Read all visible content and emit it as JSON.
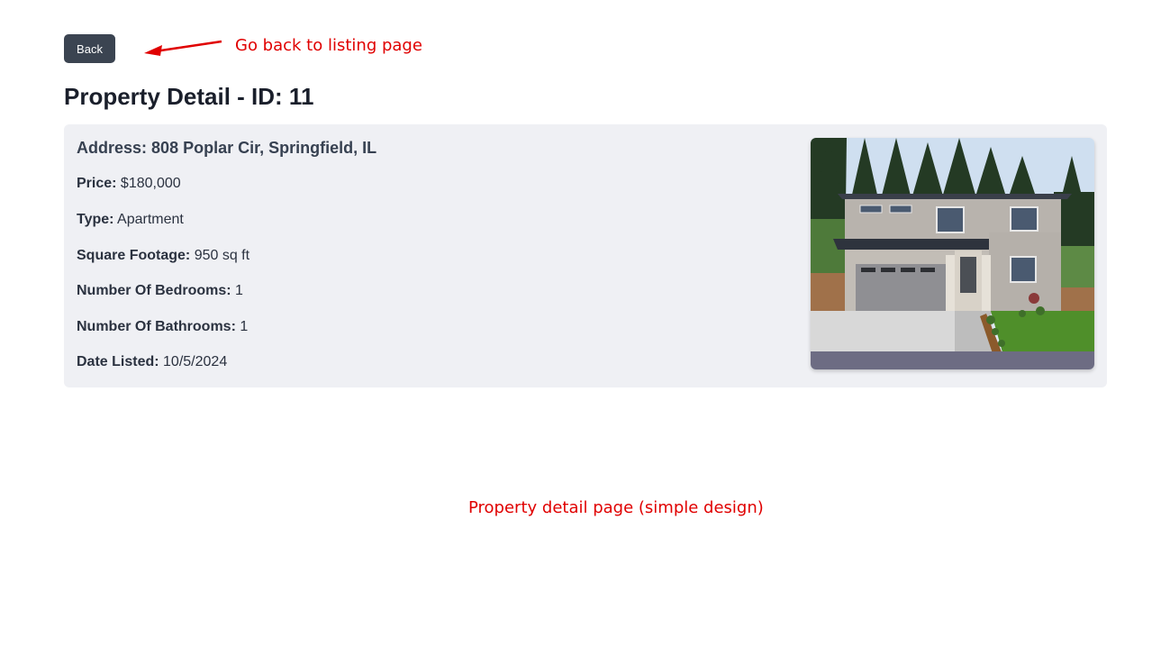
{
  "toolbar": {
    "back_label": "Back"
  },
  "annotations": {
    "back_note": "Go back to listing page",
    "page_note": "Property detail page (simple design)",
    "color": "#e00000"
  },
  "page": {
    "title": "Property Detail - ID: 11"
  },
  "property": {
    "address_label": "Address:",
    "address": "808 Poplar Cir, Springfield, IL",
    "fields": [
      {
        "label": "Price:",
        "value": "$180,000"
      },
      {
        "label": "Type:",
        "value": "Apartment"
      },
      {
        "label": "Square Footage:",
        "value": "950 sq ft"
      },
      {
        "label": "Number Of Bedrooms:",
        "value": "1"
      },
      {
        "label": "Number Of Bathrooms:",
        "value": "1"
      },
      {
        "label": "Date Listed:",
        "value": "10/5/2024"
      }
    ],
    "photo_icon": "house-photo"
  },
  "colors": {
    "button_bg": "#3b4451",
    "card_bg": "#eff0f4",
    "title_text": "#1a1f2b"
  }
}
